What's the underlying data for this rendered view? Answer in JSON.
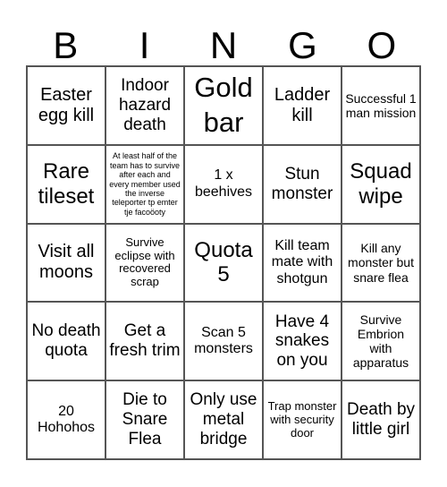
{
  "header": {
    "letters": [
      "B",
      "I",
      "N",
      "G",
      "O"
    ]
  },
  "cells": [
    [
      "Easter egg kill",
      "Indoor hazard death",
      "Gold bar",
      "Ladder kill",
      "Successful 1 man mission"
    ],
    [
      "Rare tileset",
      "At least half of the team has to survive after each and every member used the inverse teleporter tp emter tje facoöoty",
      "1 x beehives",
      "Stun monster",
      "Squad wipe"
    ],
    [
      "Visit all moons",
      "Survive eclipse with recovered scrap",
      "Quota 5",
      "Kill team mate with shotgun",
      "Kill any monster but snare flea"
    ],
    [
      "No death quota",
      "Get a fresh trim",
      "Scan 5 monsters",
      "Have 4 snakes on you",
      "Survive Embrion with apparatus"
    ],
    [
      "20 Hohohos",
      "Die to Snare Flea",
      "Only use metal bridge",
      "Trap monster with security door",
      "Death by little girl"
    ]
  ]
}
